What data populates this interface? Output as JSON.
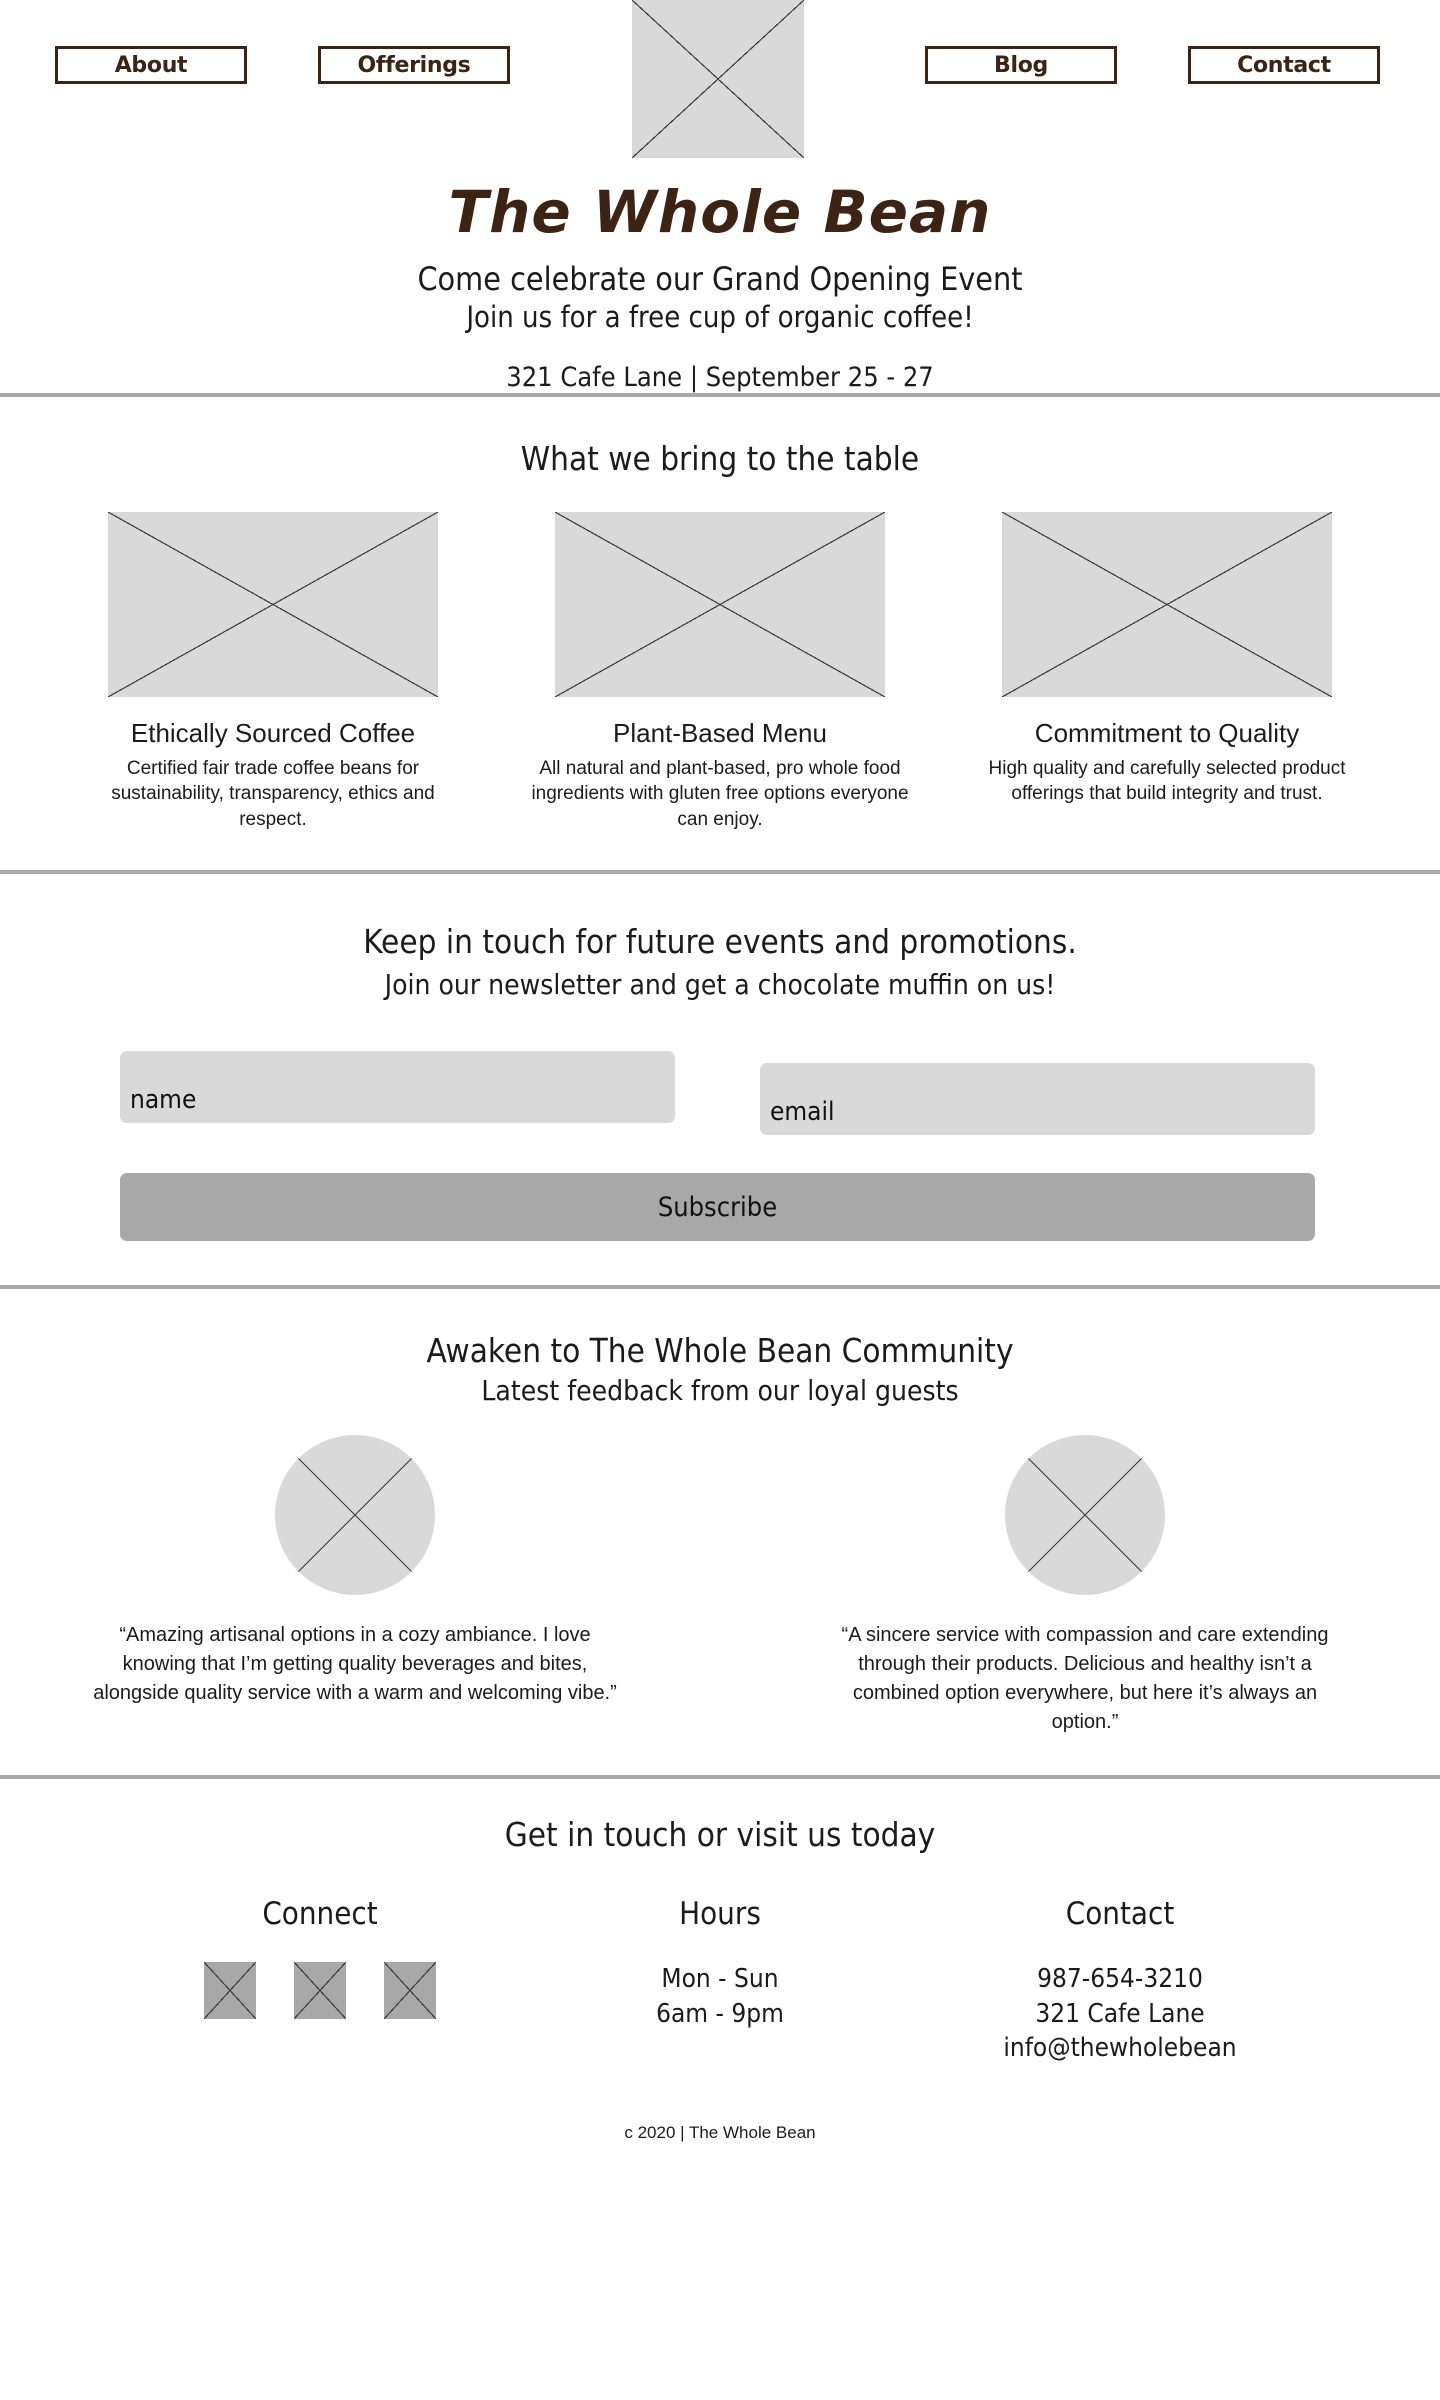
{
  "header": {
    "nav": [
      {
        "label": "About",
        "name": "nav-about"
      },
      {
        "label": "Offerings",
        "name": "nav-offerings"
      },
      {
        "label": "Blog",
        "name": "nav-blog"
      },
      {
        "label": "Contact",
        "name": "nav-contact"
      }
    ],
    "logo_placeholder": "logo-image-placeholder"
  },
  "hero": {
    "title": "The Whole Bean",
    "line1": "Come celebrate our Grand Opening Event",
    "line2": "Join us for a free cup of organic coffee!",
    "meta": "321 Cafe Lane | September 25 - 27"
  },
  "features": {
    "title": "What we bring to the table",
    "items": [
      {
        "heading": "Ethically Sourced Coffee",
        "body": "Certified fair trade coffee beans for sustainability, transparency, ethics and respect."
      },
      {
        "heading": "Plant-Based Menu",
        "body": "All natural and plant-based, pro whole food ingredients with gluten free options everyone can enjoy."
      },
      {
        "heading": "Commitment to Quality",
        "body": "High quality and carefully selected product offerings that build integrity and trust."
      }
    ]
  },
  "newsletter": {
    "heading": "Keep in touch for future events and promotions.",
    "subheading": "Join our newsletter and get a chocolate muffin on us!",
    "name_placeholder": "name",
    "name_value": "",
    "email_placeholder": "email",
    "email_value": "",
    "subscribe_label": "Subscribe"
  },
  "testimonials": {
    "heading": "Awaken to The Whole Bean Community",
    "subheading": "Latest feedback from our loyal guests",
    "items": [
      {
        "quote": "“Amazing artisanal options in a cozy ambiance. I love knowing that I’m getting quality beverages and bites, alongside quality service with a warm and welcoming vibe.”"
      },
      {
        "quote": "“A sincere service with compassion and care extending through their products. Delicious and healthy isn’t a combined option everywhere, but here it’s always an option.”"
      }
    ]
  },
  "footer": {
    "heading": "Get in touch or visit us today",
    "connect": {
      "title": "Connect",
      "social_icons": [
        "social-icon-1",
        "social-icon-2",
        "social-icon-3"
      ]
    },
    "hours": {
      "title": "Hours",
      "days": "Mon - Sun",
      "times": "6am - 9pm"
    },
    "contact": {
      "title": "Contact",
      "phone": "987-654-3210",
      "address": "321 Cafe Lane",
      "email": "info@thewholebean"
    },
    "copyright": "c 2020 | The Whole Bean"
  },
  "colors": {
    "brand_brown": "#3d2314",
    "divider_gray": "#a9a9a9",
    "placeholder_gray": "#d9d9d9",
    "button_gray": "#a8a8a8",
    "text": "#1b1b1b"
  }
}
